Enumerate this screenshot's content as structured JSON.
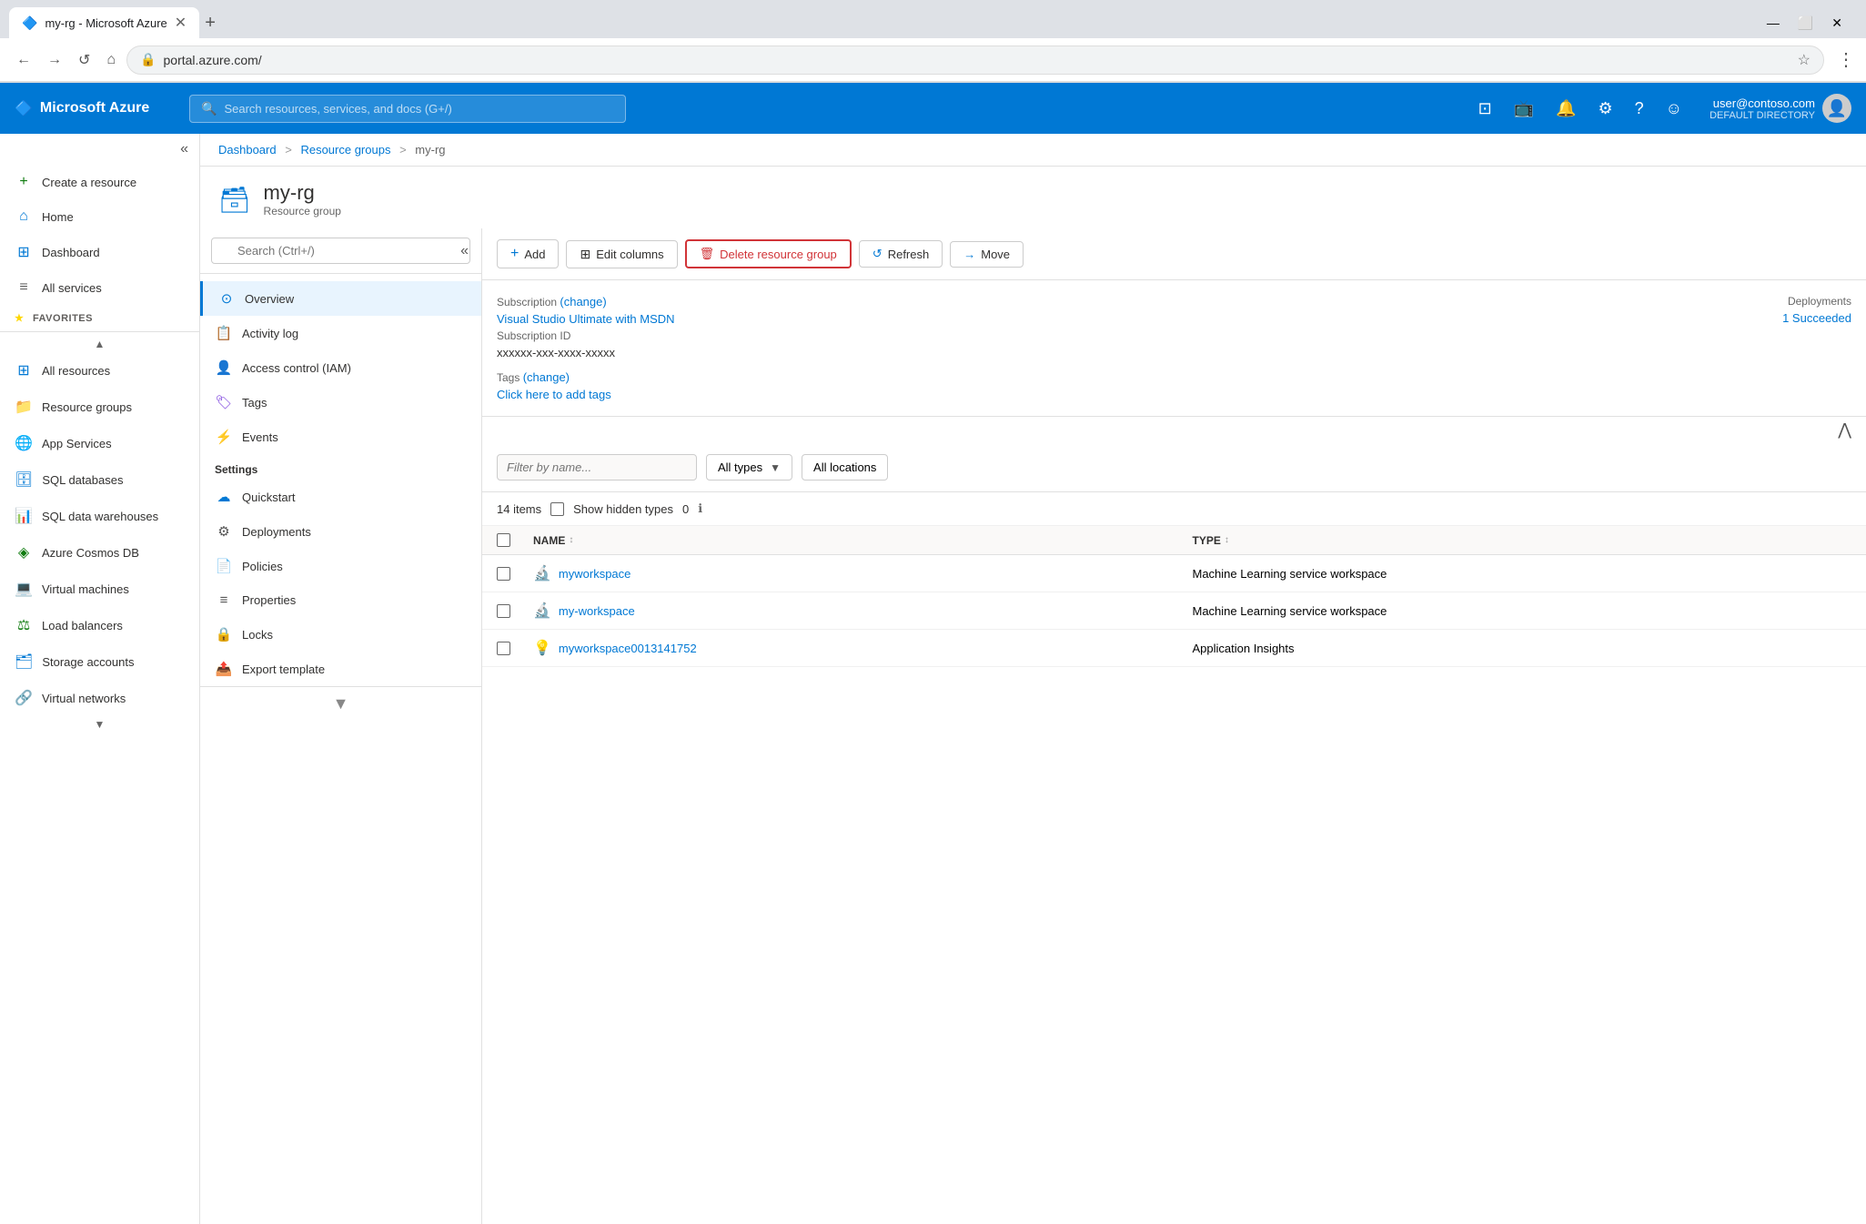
{
  "browser": {
    "tab_title": "my-rg - Microsoft Azure",
    "tab_icon": "🔷",
    "new_tab_icon": "+",
    "address": "portal.azure.com/",
    "back_icon": "←",
    "forward_icon": "→",
    "reload_icon": "↺",
    "home_icon": "⌂",
    "star_icon": "☆",
    "menu_icon": "⋮",
    "minimize_icon": "—",
    "maximize_icon": "⬜",
    "close_icon": "✕"
  },
  "topbar": {
    "brand": "Microsoft Azure",
    "brand_icon": "🔷",
    "search_placeholder": "Search resources, services, and docs (G+/)",
    "icons": [
      "⊡",
      "🖥",
      "🔔",
      "⚙",
      "?",
      "☺"
    ],
    "user_email": "user@contoso.com",
    "user_directory": "DEFAULT DIRECTORY"
  },
  "sidebar": {
    "collapse_icon": "«",
    "create_resource": "Create a resource",
    "home": "Home",
    "dashboard": "Dashboard",
    "all_services": "All services",
    "favorites_label": "FAVORITES",
    "items": [
      {
        "id": "all-resources",
        "label": "All resources",
        "icon": "⊞"
      },
      {
        "id": "resource-groups",
        "label": "Resource groups",
        "icon": "📁"
      },
      {
        "id": "app-services",
        "label": "App Services",
        "icon": "🌐"
      },
      {
        "id": "sql-databases",
        "label": "SQL databases",
        "icon": "🗄"
      },
      {
        "id": "sql-data-warehouses",
        "label": "SQL data warehouses",
        "icon": "📊"
      },
      {
        "id": "azure-cosmos-db",
        "label": "Azure Cosmos DB",
        "icon": "🌑"
      },
      {
        "id": "virtual-machines",
        "label": "Virtual machines",
        "icon": "💻"
      },
      {
        "id": "load-balancers",
        "label": "Load balancers",
        "icon": "◈"
      },
      {
        "id": "storage-accounts",
        "label": "Storage accounts",
        "icon": "🗂"
      },
      {
        "id": "virtual-networks",
        "label": "Virtual networks",
        "icon": "🔗"
      }
    ],
    "scroll_up_icon": "▲",
    "scroll_down_icon": "▼"
  },
  "breadcrumb": {
    "items": [
      "Dashboard",
      "Resource groups",
      "my-rg"
    ],
    "separators": [
      ">",
      ">"
    ]
  },
  "resource_group": {
    "icon": "🗃",
    "name": "my-rg",
    "type": "Resource group"
  },
  "nav_panel": {
    "search_placeholder": "Search (Ctrl+/)",
    "collapse_icon": "«",
    "items": [
      {
        "id": "overview",
        "label": "Overview",
        "icon": "⊙",
        "active": true
      },
      {
        "id": "activity-log",
        "label": "Activity log",
        "icon": "📋"
      },
      {
        "id": "access-control",
        "label": "Access control (IAM)",
        "icon": "👤"
      },
      {
        "id": "tags",
        "label": "Tags",
        "icon": "🏷"
      },
      {
        "id": "events",
        "label": "Events",
        "icon": "⚡"
      }
    ],
    "settings_label": "Settings",
    "settings_items": [
      {
        "id": "quickstart",
        "label": "Quickstart",
        "icon": "☁"
      },
      {
        "id": "deployments",
        "label": "Deployments",
        "icon": "⚙"
      },
      {
        "id": "policies",
        "label": "Policies",
        "icon": "📄"
      },
      {
        "id": "properties",
        "label": "Properties",
        "icon": "≡"
      },
      {
        "id": "locks",
        "label": "Locks",
        "icon": "🔒"
      },
      {
        "id": "export-template",
        "label": "Export template",
        "icon": "📤"
      }
    ]
  },
  "resource_panel": {
    "toolbar": {
      "add_label": "Add",
      "add_icon": "+",
      "edit_columns_label": "Edit columns",
      "edit_columns_icon": "⊞",
      "delete_label": "Delete resource group",
      "delete_icon": "🗑",
      "refresh_label": "Refresh",
      "refresh_icon": "↺",
      "move_label": "Move",
      "move_icon": "→"
    },
    "info": {
      "subscription_label": "Subscription",
      "subscription_change": "(change)",
      "subscription_value": "Visual Studio Ultimate with MSDN",
      "subscription_id_label": "Subscription ID",
      "subscription_id_value": "xxxxxx-xxx-xxxx-xxxxx",
      "tags_label": "Tags",
      "tags_change": "(change)",
      "tags_link": "Click here to add tags",
      "deployments_label": "Deployments",
      "deployments_value": "1 Succeeded"
    },
    "collapse_icon": "⋀",
    "filter": {
      "name_placeholder": "Filter by name...",
      "type_label": "All types",
      "type_arrow": "▼",
      "location_label": "All locations"
    },
    "items_count": "14 items",
    "show_hidden": "Show hidden types",
    "show_hidden_count": "0",
    "info_icon": "ℹ",
    "table": {
      "columns": [
        "NAME",
        "TYPE"
      ],
      "rows": [
        {
          "name": "myworkspace",
          "type": "Machine Learning service workspace",
          "icon": "🔬",
          "icon_color": "#0078d4"
        },
        {
          "name": "my-workspace",
          "type": "Machine Learning service workspace",
          "icon": "🔬",
          "icon_color": "#0078d4"
        },
        {
          "name": "myworkspace0013141752",
          "type": "Application Insights",
          "icon": "💡",
          "icon_color": "#773adc"
        }
      ]
    }
  }
}
